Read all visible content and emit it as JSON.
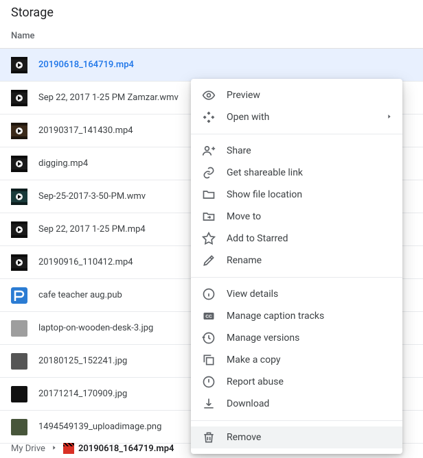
{
  "page": {
    "title": "Storage",
    "column_header": "Name"
  },
  "files": [
    {
      "name": "20190618_164719.mp4",
      "thumb": "video-dark",
      "selected": true
    },
    {
      "name": "Sep 22, 2017 1-25 PM Zamzar.wmv",
      "thumb": "video-dark"
    },
    {
      "name": "20190317_141430.mp4",
      "thumb": "video-brown"
    },
    {
      "name": "digging.mp4",
      "thumb": "video-dark"
    },
    {
      "name": "Sep-25-2017-3-50-PM.wmv",
      "thumb": "video-teal"
    },
    {
      "name": "Sep 22, 2017 1-25 PM.mp4",
      "thumb": "video-dark"
    },
    {
      "name": "20190916_110412.mp4",
      "thumb": "video-dark"
    },
    {
      "name": "cafe teacher aug.pub",
      "thumb": "publisher"
    },
    {
      "name": "laptop-on-wooden-desk-3.jpg",
      "thumb": "image-gray"
    },
    {
      "name": "20180125_152241.jpg",
      "thumb": "image-dark"
    },
    {
      "name": "20171214_170909.jpg",
      "thumb": "image-black"
    },
    {
      "name": "1494549139_uploadimage.png",
      "thumb": "image-camo"
    }
  ],
  "breadcrumb": {
    "root": "My Drive",
    "current": "20190618_164719.mp4"
  },
  "context_menu": {
    "preview": "Preview",
    "open_with": "Open with",
    "share": "Share",
    "get_link": "Get shareable link",
    "show_location": "Show file location",
    "move_to": "Move to",
    "add_starred": "Add to Starred",
    "rename": "Rename",
    "view_details": "View details",
    "captions": "Manage caption tracks",
    "versions": "Manage versions",
    "copy": "Make a copy",
    "report": "Report abuse",
    "download": "Download",
    "remove": "Remove"
  }
}
